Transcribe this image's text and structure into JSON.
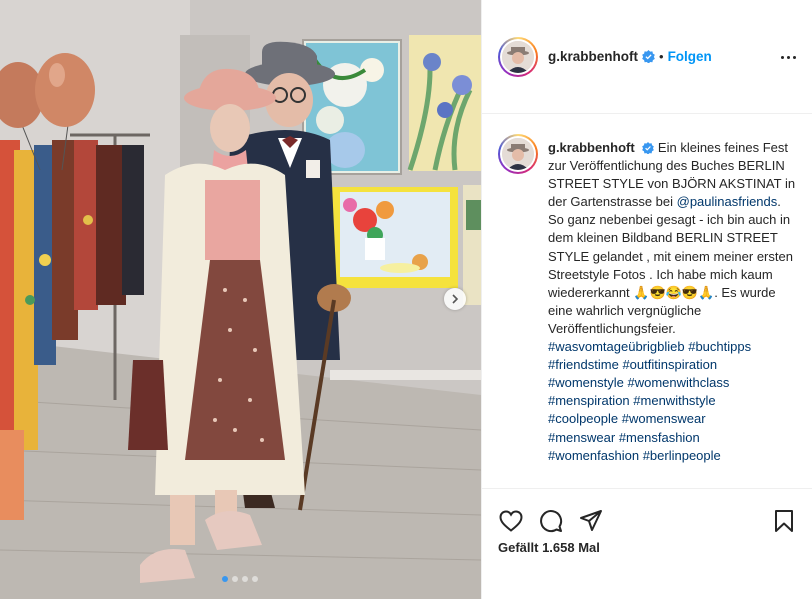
{
  "post": {
    "username": "g.krabbenhoft",
    "separator": "•",
    "follow_label": "Folgen",
    "caption_text": "Ein kleines feines Fest zur Veröffentlichung des Buches BERLIN STREET STYLE von BJÖRN AKSTINAT in der Gartenstrasse bei ",
    "caption_mention": "@paulinasfriends",
    "caption_text_2": ". So ganz nebenbei gesagt - ich bin auch in dem kleinen Bildband  BERLIN STREET STYLE gelandet , mit einem meiner ersten Streetstyle Fotos . Ich habe mich kaum wiedererkannt 🙏😎😂😎🙏. Es wurde eine wahrlich vergnügliche Veröffentlichungsfeier.",
    "hashtags": [
      "#wasvomtageübrigblieb",
      "#buchtipps",
      "#friendstime",
      "#outfitinspiration",
      "#womenstyle",
      "#womenwithclass",
      "#menspiration",
      "#menwithstyle",
      "#coolpeople",
      "#womenswear",
      "#menswear",
      "#mensfashion",
      "#womenfashion",
      "#berlinpeople"
    ],
    "likes_text": "Gefällt 1.658 Mal",
    "carousel": {
      "slides": 4,
      "active": 1
    }
  },
  "icons": {
    "verified": "verified-badge-icon",
    "more": "more-options-icon",
    "like": "heart-icon",
    "comment": "comment-bubble-icon",
    "share": "paper-plane-icon",
    "save": "bookmark-icon",
    "next": "chevron-right-icon"
  },
  "colors": {
    "accent": "#0095f6",
    "link": "#00376b",
    "text": "#262626",
    "divider": "#efefef",
    "active_dot": "#3897f0"
  }
}
